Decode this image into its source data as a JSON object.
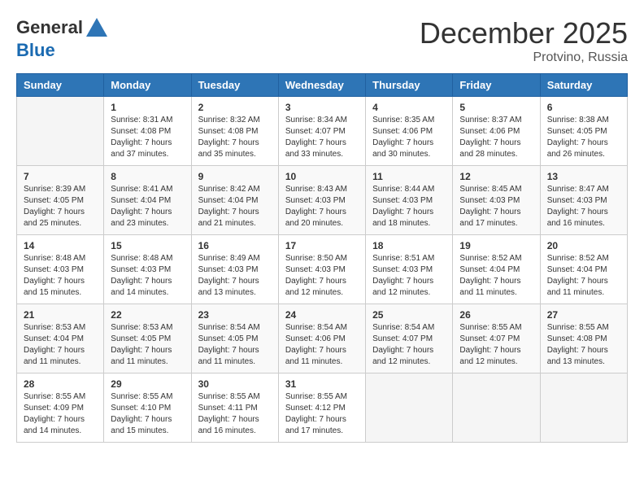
{
  "header": {
    "logo_general": "General",
    "logo_blue": "Blue",
    "month": "December 2025",
    "location": "Protvino, Russia"
  },
  "weekdays": [
    "Sunday",
    "Monday",
    "Tuesday",
    "Wednesday",
    "Thursday",
    "Friday",
    "Saturday"
  ],
  "weeks": [
    [
      {
        "day": "",
        "info": ""
      },
      {
        "day": "1",
        "info": "Sunrise: 8:31 AM\nSunset: 4:08 PM\nDaylight: 7 hours\nand 37 minutes."
      },
      {
        "day": "2",
        "info": "Sunrise: 8:32 AM\nSunset: 4:08 PM\nDaylight: 7 hours\nand 35 minutes."
      },
      {
        "day": "3",
        "info": "Sunrise: 8:34 AM\nSunset: 4:07 PM\nDaylight: 7 hours\nand 33 minutes."
      },
      {
        "day": "4",
        "info": "Sunrise: 8:35 AM\nSunset: 4:06 PM\nDaylight: 7 hours\nand 30 minutes."
      },
      {
        "day": "5",
        "info": "Sunrise: 8:37 AM\nSunset: 4:06 PM\nDaylight: 7 hours\nand 28 minutes."
      },
      {
        "day": "6",
        "info": "Sunrise: 8:38 AM\nSunset: 4:05 PM\nDaylight: 7 hours\nand 26 minutes."
      }
    ],
    [
      {
        "day": "7",
        "info": "Sunrise: 8:39 AM\nSunset: 4:05 PM\nDaylight: 7 hours\nand 25 minutes."
      },
      {
        "day": "8",
        "info": "Sunrise: 8:41 AM\nSunset: 4:04 PM\nDaylight: 7 hours\nand 23 minutes."
      },
      {
        "day": "9",
        "info": "Sunrise: 8:42 AM\nSunset: 4:04 PM\nDaylight: 7 hours\nand 21 minutes."
      },
      {
        "day": "10",
        "info": "Sunrise: 8:43 AM\nSunset: 4:03 PM\nDaylight: 7 hours\nand 20 minutes."
      },
      {
        "day": "11",
        "info": "Sunrise: 8:44 AM\nSunset: 4:03 PM\nDaylight: 7 hours\nand 18 minutes."
      },
      {
        "day": "12",
        "info": "Sunrise: 8:45 AM\nSunset: 4:03 PM\nDaylight: 7 hours\nand 17 minutes."
      },
      {
        "day": "13",
        "info": "Sunrise: 8:47 AM\nSunset: 4:03 PM\nDaylight: 7 hours\nand 16 minutes."
      }
    ],
    [
      {
        "day": "14",
        "info": "Sunrise: 8:48 AM\nSunset: 4:03 PM\nDaylight: 7 hours\nand 15 minutes."
      },
      {
        "day": "15",
        "info": "Sunrise: 8:48 AM\nSunset: 4:03 PM\nDaylight: 7 hours\nand 14 minutes."
      },
      {
        "day": "16",
        "info": "Sunrise: 8:49 AM\nSunset: 4:03 PM\nDaylight: 7 hours\nand 13 minutes."
      },
      {
        "day": "17",
        "info": "Sunrise: 8:50 AM\nSunset: 4:03 PM\nDaylight: 7 hours\nand 12 minutes."
      },
      {
        "day": "18",
        "info": "Sunrise: 8:51 AM\nSunset: 4:03 PM\nDaylight: 7 hours\nand 12 minutes."
      },
      {
        "day": "19",
        "info": "Sunrise: 8:52 AM\nSunset: 4:04 PM\nDaylight: 7 hours\nand 11 minutes."
      },
      {
        "day": "20",
        "info": "Sunrise: 8:52 AM\nSunset: 4:04 PM\nDaylight: 7 hours\nand 11 minutes."
      }
    ],
    [
      {
        "day": "21",
        "info": "Sunrise: 8:53 AM\nSunset: 4:04 PM\nDaylight: 7 hours\nand 11 minutes."
      },
      {
        "day": "22",
        "info": "Sunrise: 8:53 AM\nSunset: 4:05 PM\nDaylight: 7 hours\nand 11 minutes."
      },
      {
        "day": "23",
        "info": "Sunrise: 8:54 AM\nSunset: 4:05 PM\nDaylight: 7 hours\nand 11 minutes."
      },
      {
        "day": "24",
        "info": "Sunrise: 8:54 AM\nSunset: 4:06 PM\nDaylight: 7 hours\nand 11 minutes."
      },
      {
        "day": "25",
        "info": "Sunrise: 8:54 AM\nSunset: 4:07 PM\nDaylight: 7 hours\nand 12 minutes."
      },
      {
        "day": "26",
        "info": "Sunrise: 8:55 AM\nSunset: 4:07 PM\nDaylight: 7 hours\nand 12 minutes."
      },
      {
        "day": "27",
        "info": "Sunrise: 8:55 AM\nSunset: 4:08 PM\nDaylight: 7 hours\nand 13 minutes."
      }
    ],
    [
      {
        "day": "28",
        "info": "Sunrise: 8:55 AM\nSunset: 4:09 PM\nDaylight: 7 hours\nand 14 minutes."
      },
      {
        "day": "29",
        "info": "Sunrise: 8:55 AM\nSunset: 4:10 PM\nDaylight: 7 hours\nand 15 minutes."
      },
      {
        "day": "30",
        "info": "Sunrise: 8:55 AM\nSunset: 4:11 PM\nDaylight: 7 hours\nand 16 minutes."
      },
      {
        "day": "31",
        "info": "Sunrise: 8:55 AM\nSunset: 4:12 PM\nDaylight: 7 hours\nand 17 minutes."
      },
      {
        "day": "",
        "info": ""
      },
      {
        "day": "",
        "info": ""
      },
      {
        "day": "",
        "info": ""
      }
    ]
  ]
}
